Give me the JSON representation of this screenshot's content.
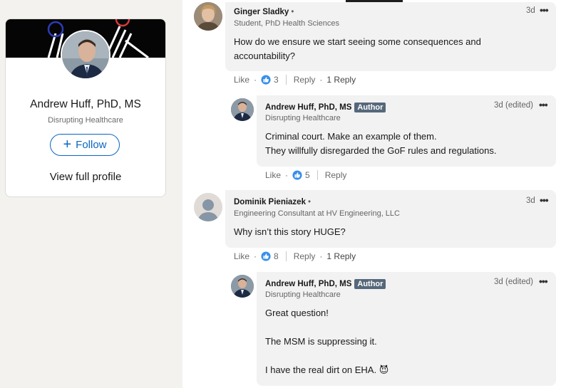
{
  "profile": {
    "name": "Andrew Huff, PhD, MS",
    "headline": "Disrupting Healthcare",
    "follow_label": "Follow",
    "view_profile_label": "View full profile"
  },
  "comments": [
    {
      "name": "Ginger Sladky",
      "degree": "•",
      "headline": "Student, PhD Health Sciences",
      "time": "3d",
      "body_lines": [
        "How do we ensure we start seeing some consequences and",
        "accountability?"
      ],
      "like_label": "Like",
      "reaction_count": "3",
      "reply_label": "Reply",
      "reply_count_label": "1 Reply",
      "reply": {
        "name": "Andrew Huff, PhD, MS",
        "badge": "Author",
        "headline": "Disrupting Healthcare",
        "time": "3d (edited)",
        "body_lines": [
          "Criminal court. Make an example of them.",
          "They willfully disregarded the GoF rules and regulations."
        ],
        "like_label": "Like",
        "reaction_count": "5",
        "reply_label": "Reply"
      }
    },
    {
      "name": "Dominik Pieniazek",
      "degree": "•",
      "headline": "Engineering Consultant at HV Engineering, LLC",
      "time": "3d",
      "body_lines": [
        "Why isn’t this story HUGE?"
      ],
      "like_label": "Like",
      "reaction_count": "8",
      "reply_label": "Reply",
      "reply_count_label": "1 Reply",
      "reply": {
        "name": "Andrew Huff, PhD, MS",
        "badge": "Author",
        "headline": "Disrupting Healthcare",
        "time": "3d (edited)",
        "body_lines": [
          "Great question!",
          "",
          "The MSM is suppressing it.",
          "",
          "I have the real dirt on EHA. 😈"
        ]
      }
    }
  ],
  "icons": {
    "like_icon": "thumbs-up-icon",
    "more_icon": "more-options-icon",
    "colors": {
      "brand": "#0a66c2",
      "badge": "#56687a",
      "bubble": "#f2f2f2"
    }
  }
}
